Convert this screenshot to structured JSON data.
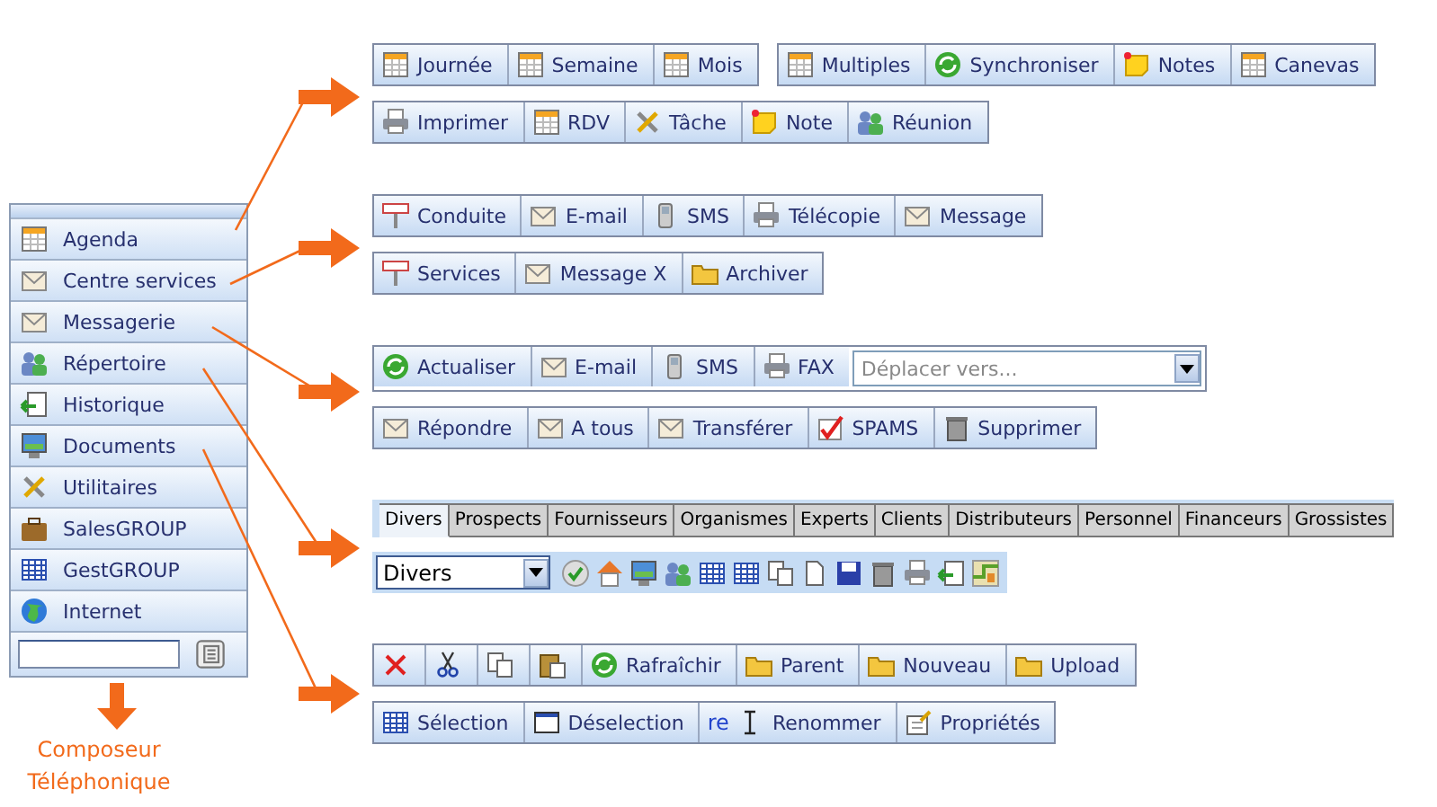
{
  "sidebar": {
    "items": [
      {
        "label": "Agenda"
      },
      {
        "label": "Centre services"
      },
      {
        "label": "Messagerie"
      },
      {
        "label": "Répertoire"
      },
      {
        "label": "Historique"
      },
      {
        "label": "Documents"
      },
      {
        "label": "Utilitaires"
      },
      {
        "label": "SalesGROUP"
      },
      {
        "label": "GestGROUP"
      },
      {
        "label": "Internet"
      }
    ]
  },
  "caption": "Composeur Téléphonique",
  "sections": [
    {
      "rows": [
        {
          "kind": "toolbars",
          "toolbars": [
            {
              "items": [
                {
                  "kind": "button",
                  "label": "Journée"
                },
                {
                  "kind": "button",
                  "label": "Semaine"
                },
                {
                  "kind": "button",
                  "label": "Mois"
                }
              ]
            },
            {
              "items": [
                {
                  "kind": "button",
                  "label": "Multiples"
                },
                {
                  "kind": "button",
                  "label": "Synchroniser"
                },
                {
                  "kind": "button",
                  "label": "Notes"
                },
                {
                  "kind": "button",
                  "label": "Canevas"
                }
              ]
            }
          ]
        },
        {
          "kind": "toolbars",
          "toolbars": [
            {
              "items": [
                {
                  "kind": "button",
                  "label": "Imprimer"
                },
                {
                  "kind": "button",
                  "label": "RDV"
                },
                {
                  "kind": "button",
                  "label": "Tâche"
                },
                {
                  "kind": "button",
                  "label": "Note"
                },
                {
                  "kind": "button",
                  "label": "Réunion"
                }
              ]
            }
          ]
        }
      ]
    },
    {
      "rows": [
        {
          "kind": "toolbars",
          "toolbars": [
            {
              "items": [
                {
                  "kind": "button",
                  "label": "Conduite"
                },
                {
                  "kind": "button",
                  "label": "E-mail"
                },
                {
                  "kind": "button",
                  "label": "SMS"
                },
                {
                  "kind": "button",
                  "label": "Télécopie"
                },
                {
                  "kind": "button",
                  "label": "Message"
                }
              ]
            }
          ]
        },
        {
          "kind": "toolbars",
          "toolbars": [
            {
              "items": [
                {
                  "kind": "button",
                  "label": "Services"
                },
                {
                  "kind": "button",
                  "label": "Message X"
                },
                {
                  "kind": "button",
                  "label": "Archiver"
                }
              ]
            }
          ]
        }
      ]
    },
    {
      "rows": [
        {
          "kind": "toolbars",
          "toolbars": [
            {
              "items": [
                {
                  "kind": "button",
                  "label": "Actualiser"
                },
                {
                  "kind": "button",
                  "label": "E-mail"
                },
                {
                  "kind": "button",
                  "label": "SMS"
                },
                {
                  "kind": "button",
                  "label": "FAX"
                },
                {
                  "kind": "dropdown",
                  "value": "Déplacer vers..."
                }
              ]
            }
          ]
        },
        {
          "kind": "toolbars",
          "toolbars": [
            {
              "items": [
                {
                  "kind": "button",
                  "label": "Répondre"
                },
                {
                  "kind": "button",
                  "label": "A tous"
                },
                {
                  "kind": "button",
                  "label": "Transférer"
                },
                {
                  "kind": "button",
                  "label": "SPAMS"
                },
                {
                  "kind": "button",
                  "label": "Supprimer"
                }
              ]
            }
          ]
        }
      ]
    },
    {
      "rows": [
        {
          "kind": "tabs",
          "tabs": [
            {
              "label": "Divers",
              "selected": true
            },
            {
              "label": "Prospects",
              "selected": false
            },
            {
              "label": "Fournisseurs",
              "selected": false
            },
            {
              "label": "Organismes",
              "selected": false
            },
            {
              "label": "Experts",
              "selected": false
            },
            {
              "label": "Clients",
              "selected": false
            },
            {
              "label": "Distributeurs",
              "selected": false
            },
            {
              "label": "Personnel",
              "selected": false
            },
            {
              "label": "Financeurs",
              "selected": false
            },
            {
              "label": "Grossistes",
              "selected": false
            }
          ]
        },
        {
          "kind": "filter",
          "select": {
            "value": "Divers"
          }
        }
      ]
    },
    {
      "rows": [
        {
          "kind": "toolbars",
          "toolbars": [
            {
              "items": [
                {
                  "kind": "button"
                },
                {
                  "kind": "button"
                },
                {
                  "kind": "button"
                },
                {
                  "kind": "button"
                },
                {
                  "kind": "button",
                  "label": "Rafraîchir"
                },
                {
                  "kind": "button",
                  "label": "Parent"
                },
                {
                  "kind": "button",
                  "label": "Nouveau"
                },
                {
                  "kind": "button",
                  "label": "Upload"
                }
              ]
            }
          ]
        },
        {
          "kind": "toolbars",
          "toolbars": [
            {
              "items": [
                {
                  "kind": "button",
                  "label": "Sélection"
                },
                {
                  "kind": "button",
                  "label": "Déselection"
                },
                {
                  "kind": "button",
                  "prefix": "re",
                  "label": "Renommer"
                },
                {
                  "kind": "button",
                  "label": "Propriétés"
                }
              ]
            }
          ]
        }
      ]
    }
  ]
}
